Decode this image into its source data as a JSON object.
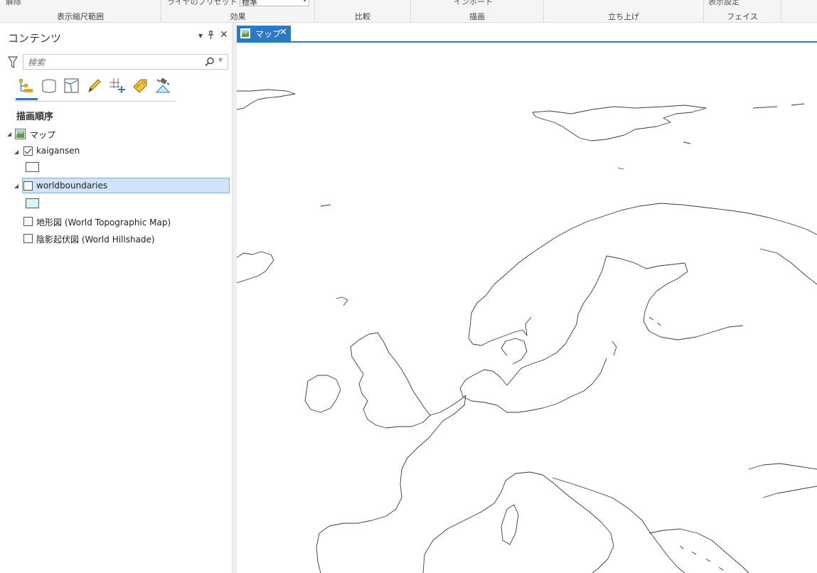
{
  "ribbon": {
    "groups": [
      {
        "label": "表示縮尺範囲",
        "cut_text": "解除"
      },
      {
        "label": "効果",
        "cut_text": "ライヤのプリセット",
        "combo_value": "標準"
      },
      {
        "label": "比較"
      },
      {
        "label": "描画",
        "cut_text": "インポート"
      },
      {
        "label": "立ち上げ"
      },
      {
        "label": "フェイス",
        "cut_text": "表示設定"
      }
    ]
  },
  "contents": {
    "title": "コンテンツ",
    "search_placeholder": "検索",
    "heading": "描画順序",
    "map_name": "マップ",
    "layers": [
      {
        "name": "kaigansen",
        "checked": true,
        "swatch_color": "#ffffff"
      },
      {
        "name": "worldboundaries",
        "checked": false,
        "selected": true,
        "swatch_color": "#d6f7f3"
      },
      {
        "name": "地形図 (World Topographic Map)",
        "checked": false
      },
      {
        "name": "陰影起伏図 (World Hillshade)",
        "checked": false
      }
    ],
    "toolbar_icons": [
      "list-by-drawing-order-icon",
      "list-by-source-icon",
      "list-by-selection-icon",
      "list-by-editing-icon",
      "list-by-snapping-icon",
      "list-by-labeling-icon",
      "list-by-perspective-imagery-icon"
    ]
  },
  "map_tab": {
    "label": "マップ"
  },
  "colors": {
    "accent": "#2b79c2",
    "selection": "#cfe4f7",
    "coastline": "#3a3a3a"
  }
}
